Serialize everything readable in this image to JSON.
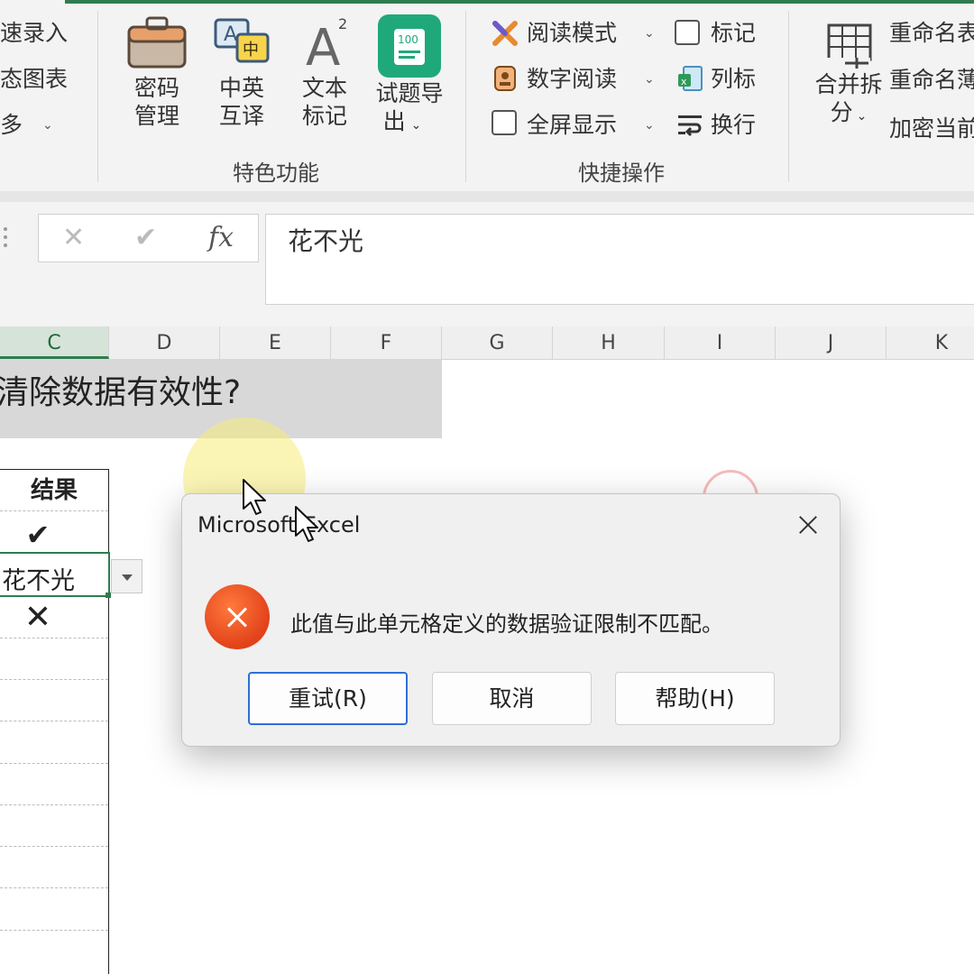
{
  "ribbon": {
    "left_items": [
      "速录入",
      "态图表",
      "多"
    ],
    "big_buttons": [
      {
        "id": "password",
        "label_lines": [
          "密码",
          "管理"
        ]
      },
      {
        "id": "translate",
        "label_lines": [
          "中英",
          "互译"
        ]
      },
      {
        "id": "text-mark",
        "label_lines": [
          "文本",
          "标记"
        ]
      },
      {
        "id": "export",
        "label_lines": [
          "试题导",
          "出"
        ]
      }
    ],
    "icon_glyphs": {
      "translate_a": "A",
      "translate_zh": "中",
      "text_mark": "A",
      "text_mark_sup": "2",
      "export_badge": "100"
    },
    "feature_group_label": "特色功能",
    "quick_items": {
      "reading_mode": "阅读模式",
      "digit_reading": "数字阅读",
      "full_screen": "全屏显示",
      "mark": "标记",
      "list_mark": "列标",
      "wrap": "换行"
    },
    "quick_group_label": "快捷操作",
    "merge_split": {
      "label_lines": [
        "合并拆",
        "分"
      ]
    },
    "rename_items": [
      "重命名表",
      "重命名薄",
      "加密当前"
    ]
  },
  "formula_bar": {
    "cancel_glyph": "✕",
    "confirm_glyph": "✔",
    "fx_label": "fx",
    "value": "花不光"
  },
  "columns": [
    "C",
    "D",
    "E",
    "F",
    "G",
    "H",
    "I",
    "J",
    "K"
  ],
  "sheet": {
    "title": "清除数据有效性?",
    "result_header": "结果",
    "rows": [
      "✔",
      "花不光",
      "✕"
    ],
    "active_cell_value": "花不光"
  },
  "dialog": {
    "title": "Microsoft Excel",
    "message": "此值与此单元格定义的数据验证限制不匹配。",
    "buttons": {
      "retry": "重试(R)",
      "cancel": "取消",
      "help": "帮助(H)"
    }
  },
  "colors": {
    "accent_green": "#2e7d4f",
    "error_orange": "#e2421a",
    "primary_button_border": "#2f6fd6"
  }
}
